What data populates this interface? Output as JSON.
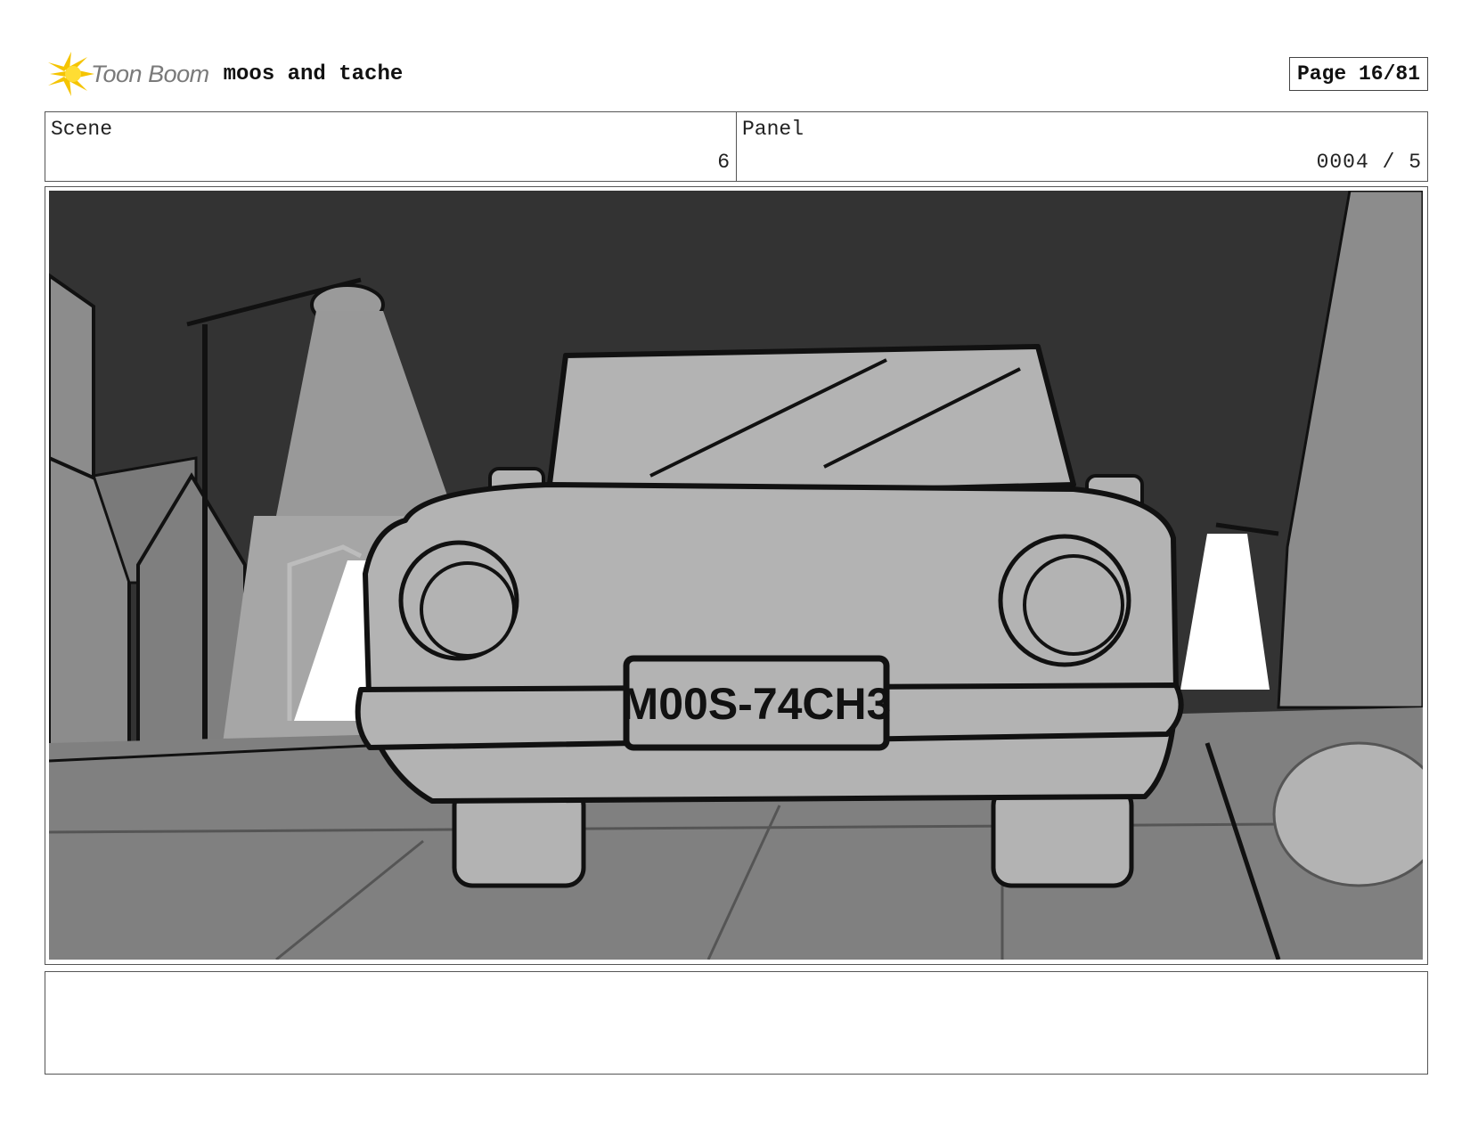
{
  "header": {
    "logo_text": "Toon Boom",
    "logo_icon": "toon-boom-burst-icon",
    "project_title": "moos and tache",
    "page_label": "Page 16/81"
  },
  "info": {
    "scene_label": "Scene",
    "scene_value": "6",
    "panel_label": "Panel",
    "panel_value": "0004 / 5"
  },
  "panel": {
    "license_plate": "M00S-74CH3",
    "colors": {
      "sky": "#333333",
      "ground": "#808080",
      "car_body": "#b3b3b3",
      "light_cone": "#ffffff",
      "building": "#8c8c8c",
      "ink": "#111111"
    }
  },
  "notes": {
    "text": ""
  }
}
